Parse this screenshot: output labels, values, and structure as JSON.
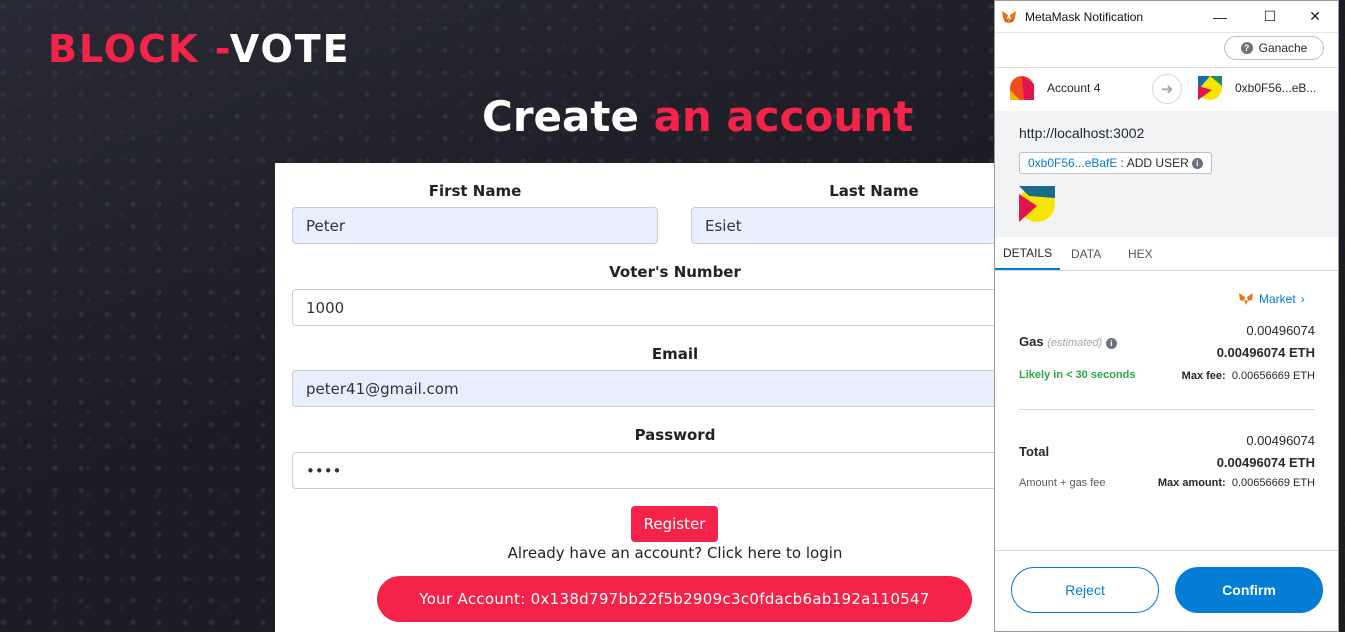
{
  "app": {
    "logo_part1": "BLOCK -",
    "logo_part2": "VOTE",
    "title_part1": "Create ",
    "title_part2": "an account"
  },
  "form": {
    "first_name_label": "First Name",
    "first_name_value": "Peter",
    "last_name_label": "Last Name",
    "last_name_value": "Esiet",
    "voter_number_label": "Voter's Number",
    "voter_number_value": "1000",
    "email_label": "Email",
    "email_value": "peter41@gmail.com",
    "password_label": "Password",
    "password_value": "••••",
    "register_label": "Register",
    "login_prompt": "Already have an account? Click here to login",
    "account_text": "Your Account: 0x138d797bb22f5b2909c3c0fdacb6ab192a110547"
  },
  "colors": {
    "accent_red": "#f5234a",
    "metamask_blue": "#037dd6",
    "likely_green": "#28a745"
  },
  "metamask": {
    "window_title": "MetaMask Notification",
    "network": "Ganache",
    "from_account": "Account 4",
    "to_address": "0xb0F56...eB...",
    "origin_url": "http://localhost:3002",
    "chip_address": "0xb0F56...eBafE",
    "chip_sep": ":",
    "add_user": "ADD USER",
    "tabs": [
      "DETAILS",
      "DATA",
      "HEX"
    ],
    "market_label": "Market",
    "gas_label": "Gas",
    "gas_estimated": "(estimated)",
    "gas_value": "0.00496074",
    "gas_value_eth": "0.00496074 ETH",
    "likely_text": "Likely in < 30 seconds",
    "max_fee_label": "Max fee:",
    "max_fee_value": "0.00656669 ETH",
    "total_label": "Total",
    "total_value": "0.00496074",
    "total_value_eth": "0.00496074 ETH",
    "amount_gas_fee": "Amount + gas fee",
    "max_amount_label": "Max amount:",
    "max_amount_value": "0.00656669 ETH",
    "reject_label": "Reject",
    "confirm_label": "Confirm"
  }
}
